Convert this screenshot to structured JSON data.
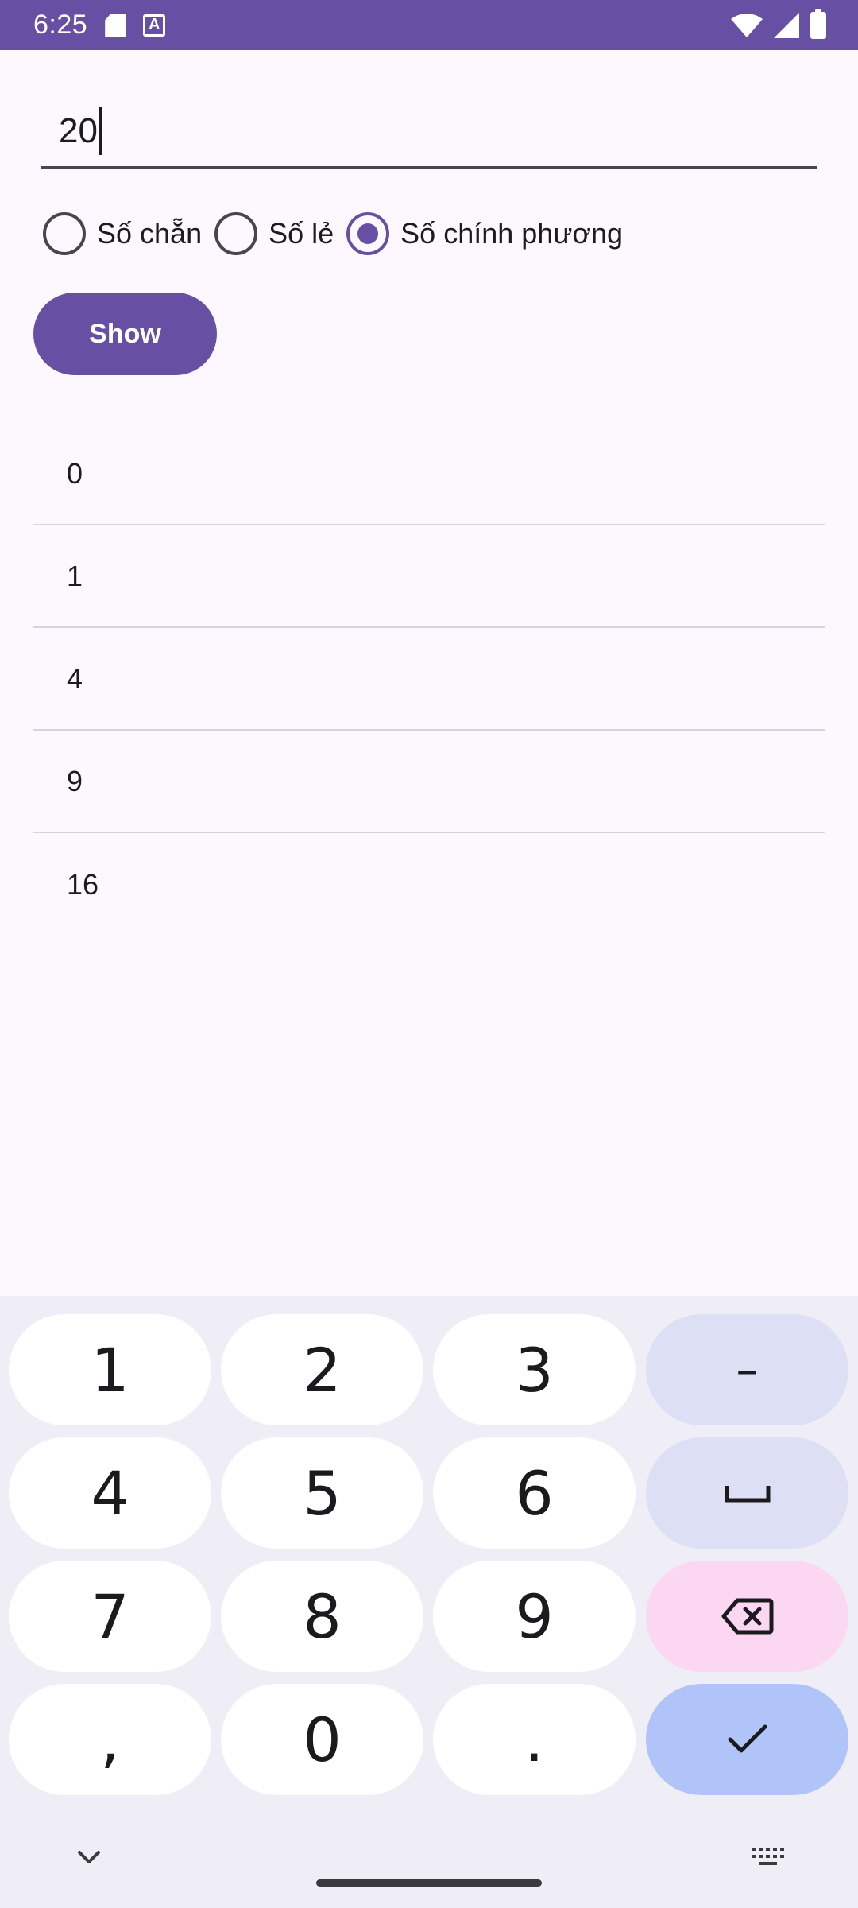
{
  "status_bar": {
    "time": "6:25",
    "icons": [
      "sd-card-icon",
      "text-a-icon",
      "wifi-icon",
      "cellular-signal-icon",
      "battery-icon"
    ],
    "background": "#6750A4"
  },
  "input": {
    "value": "20"
  },
  "radio_group": {
    "options": [
      {
        "label": "Số chẵn",
        "checked": false
      },
      {
        "label": "Số lẻ",
        "checked": false
      },
      {
        "label": "Số chính phương",
        "checked": true
      }
    ]
  },
  "button": {
    "label": "Show",
    "color": "#6750A4"
  },
  "results": [
    "0",
    "1",
    "4",
    "9",
    "16"
  ],
  "keyboard": {
    "rows": [
      [
        "1",
        "2",
        "3",
        "–"
      ],
      [
        "4",
        "5",
        "6",
        "space"
      ],
      [
        "7",
        "8",
        "9",
        "backspace"
      ],
      [
        ",",
        "0",
        ".",
        "enter"
      ]
    ],
    "keys": {
      "k1": "1",
      "k2": "2",
      "k3": "3",
      "minus": "–",
      "k4": "4",
      "k5": "5",
      "k6": "6",
      "k7": "7",
      "k8": "8",
      "k9": "9",
      "comma": ",",
      "k0": "0",
      "period": "."
    }
  }
}
